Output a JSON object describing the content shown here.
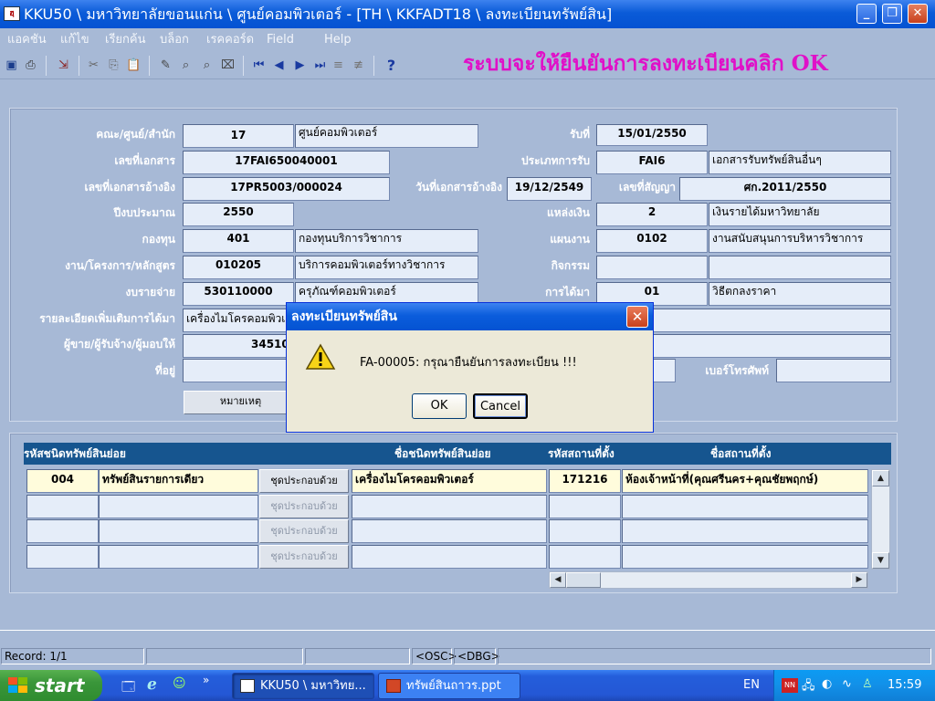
{
  "window": {
    "title": "KKU50 \\ มหาวิทยาลัยขอนแก่น \\ ศูนย์คอมพิวเตอร์ - [TH \\ KKFADT18 \\ ลงทะเบียนทรัพย์สิน]",
    "app_icon": "ฮฺ"
  },
  "menu": [
    "แอคชัน",
    "แก้ไข",
    "เรียกค้น",
    "บล็อก",
    "เรคคอร์ด",
    "Field",
    "Help"
  ],
  "banner": "ระบบจะให้ยืนยันการลงทะเบียนคลิก OK",
  "form": {
    "faculty_label": "คณะ/ศูนย์/สำนัก",
    "faculty_code": "17",
    "faculty_name": "ศูนย์คอมพิวเตอร์",
    "date_label": "รับที่",
    "date_value": "15/01/2550",
    "docno_label": "เลขที่เอกสาร",
    "docno_value": "17FAI650040001",
    "recvtype_label": "ประเภทการรับ",
    "recvtype_code": "FAI6",
    "recvtype_name": "เอกสารรับทรัพย์สินอื่นๆ",
    "refdoc_label": "เลขที่เอกสารอ้างอิง",
    "refdoc_value": "17PR5003/000024",
    "refdate_label": "วันที่เอกสารอ้างอิง",
    "refdate_value": "19/12/2549",
    "contract_label": "เลขที่สัญญา",
    "contract_value": "ศก.2011/2550",
    "budgetyear_label": "ปีงบประมาณ",
    "budgetyear_value": "2550",
    "source_label": "แหล่งเงิน",
    "source_code": "2",
    "source_name": "เงินรายได้มหาวิทยาลัย",
    "fund_label": "กองทุน",
    "fund_code": "401",
    "fund_name": "กองทุนบริการวิชาการ",
    "plan_label": "แผนงาน",
    "plan_code": "0102",
    "plan_name": "งานสนับสนุนการบริหารวิชาการ",
    "project_label": "งาน/โครงการ/หลักสูตร",
    "project_code": "010205",
    "project_name": "บริการคอมพิวเตอร์ทางวิชาการ",
    "activity_label": "กิจกรรม",
    "expense_label": "งบรายจ่าย",
    "expense_code": "530110000",
    "expense_name": "ครุภัณฑ์คอมพิวเตอร์",
    "acquire_label": "การได้มา",
    "acquire_code": "01",
    "acquire_name": "วิธีตกลงราคา",
    "detail_label": "รายละเอียดเพิ่มเติมการได้มา",
    "detail_value": "เครื่องไมโครคอมพิวเตอร์",
    "seller_label": "ผู้ขาย/ผู้รับจ้าง/ผู้มอบให้",
    "seller_value": "34510",
    "address_label": "ที่อยู่",
    "phone_label": "เบอร์โทรศัพท์",
    "note_button": "หมายเหตุ"
  },
  "grid": {
    "headers": [
      "รหัสชนิดทรัพย์สินย่อย",
      "ชื่อชนิดทรัพย์สินย่อย",
      "รหัสสถานที่ตั้ง",
      "ชื่อสถานที่ตั้ง"
    ],
    "component_button": "ชุดประกอบด้วย",
    "rows": [
      {
        "code": "004",
        "kind": "ทรัพย์สินรายการเดียว",
        "name": "เครื่องไมโครคอมพิวเตอร์",
        "loc_code": "171216",
        "loc_name": "ห้องเจ้าหน้าที่(คุณศรีนคร+คุณชัยพฤกษ์)"
      },
      {
        "code": "",
        "kind": "",
        "name": "",
        "loc_code": "",
        "loc_name": ""
      },
      {
        "code": "",
        "kind": "",
        "name": "",
        "loc_code": "",
        "loc_name": ""
      },
      {
        "code": "",
        "kind": "",
        "name": "",
        "loc_code": "",
        "loc_name": ""
      }
    ]
  },
  "dialog": {
    "title": "ลงทะเบียนทรัพย์สิน",
    "message": "FA-00005: กรุณายืนยันการลงทะเบียน !!!",
    "ok": "OK",
    "cancel": "Cancel",
    "icon": "warning-icon"
  },
  "status": {
    "record": "Record: 1/1",
    "osc": "<OSC>",
    "dbg": "<DBG>"
  },
  "taskbar": {
    "start": "start",
    "tasks": [
      "KKU50 \\ มหาวิทย...",
      "ทรัพย์สินถาวร.ppt"
    ],
    "lang": "EN",
    "clock": "15:59"
  },
  "colors": {
    "panel_bg": "#a7b9d6",
    "field_bg": "#e5edf9",
    "grid_header": "#16558f",
    "banner": "#e010c8"
  }
}
